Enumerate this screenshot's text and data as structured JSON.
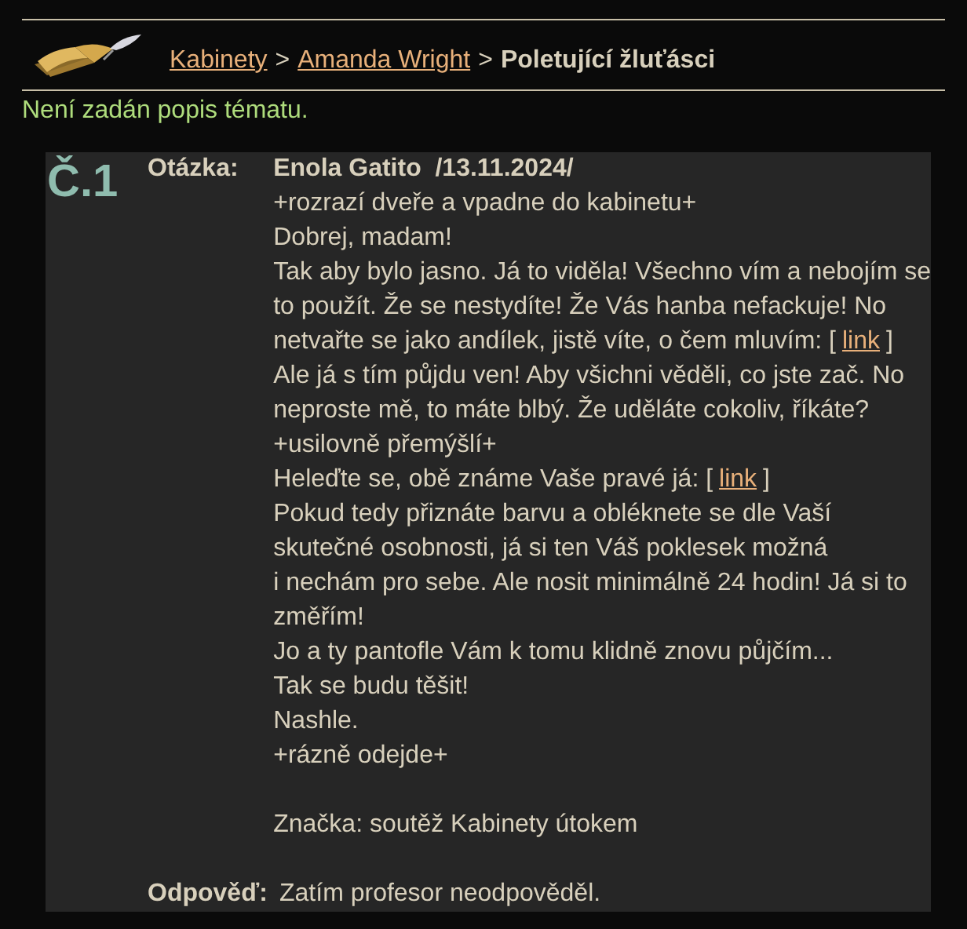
{
  "breadcrumb": [
    {
      "text": "Kabinety",
      "kind": "link"
    },
    {
      "text": "Amanda Wright",
      "kind": "link"
    },
    {
      "text": "Poletující žluťásci",
      "kind": "current"
    }
  ],
  "breadcrumb_separator": ">",
  "description": "Není zadán popis tématu.",
  "question": {
    "number": "Č.1",
    "label": "Otázka:",
    "author_line": "Enola Gatito  /13.11.2024/",
    "lines": [
      {
        "text": "+rozrazí dveře a vpadne do kabinetu+"
      },
      {
        "text": "Dobrej, madam!"
      },
      {
        "text": "Tak aby bylo jasno. Já to viděla! Všechno vím a nebojím se"
      },
      {
        "text": "to použít. Že se nestydíte! Že Vás hanba nefackuje! No"
      },
      {
        "text": "netvařte se jako andílek, jistě víte, o čem mluvím: [",
        "link": "link",
        "after": "]"
      },
      {
        "text": "Ale já s tím půjdu ven! Aby všichni věděli, co jste zač. No"
      },
      {
        "text": "neproste mě, to máte blbý. Že uděláte cokoliv, říkáte?"
      },
      {
        "text": "+usilovně přemýšlí+"
      },
      {
        "text": "Heleďte se, obě známe Vaše pravé já: [",
        "link": "link",
        "after": "]"
      },
      {
        "text": "Pokud tedy přiznáte barvu a obléknete se dle Vaší"
      },
      {
        "text": "skutečné osobnosti, já si ten Váš poklesek možná"
      },
      {
        "text": "i nechám pro sebe. Ale nosit minimálně 24 hodin! Já si to"
      },
      {
        "text": "změřím!"
      },
      {
        "text": "Jo a ty pantofle Vám k tomu klidně znovu půjčím..."
      },
      {
        "text": "Tak se budu těšit!"
      },
      {
        "text": "Nashle."
      },
      {
        "text": "+rázně odejde+"
      },
      {
        "kind": "spacer"
      },
      {
        "text": "Značka: soutěž Kabinety útokem"
      }
    ]
  },
  "answer": {
    "label": "Odpověď:",
    "text": "Zatím profesor neodpověděl."
  }
}
